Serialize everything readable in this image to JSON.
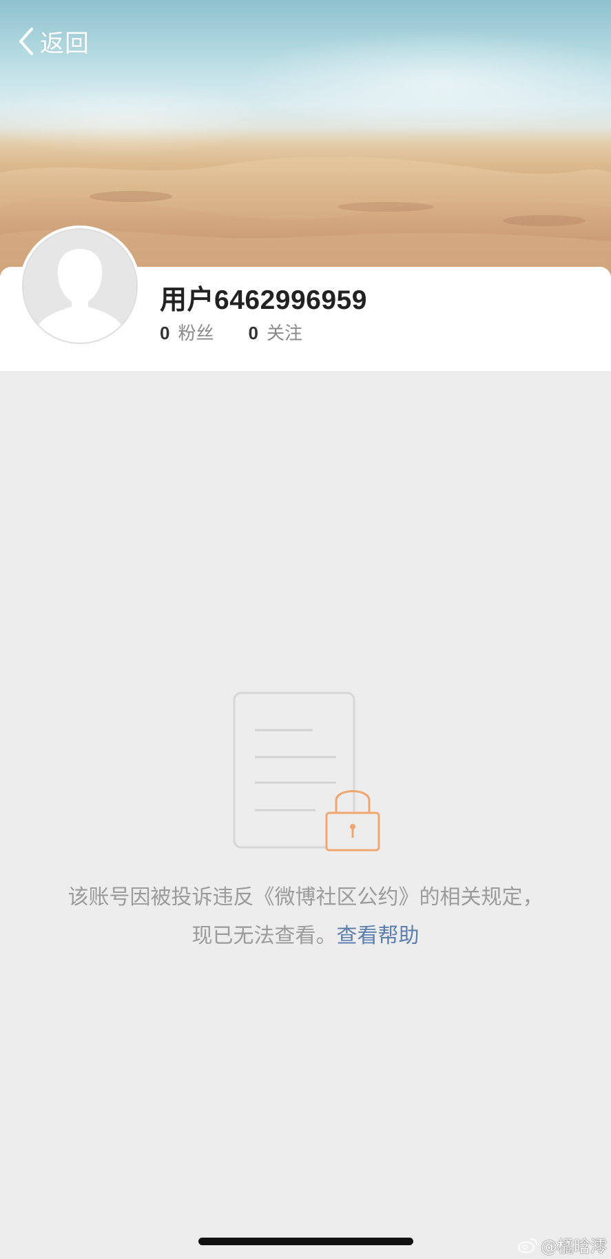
{
  "nav": {
    "back_label": "返回"
  },
  "profile": {
    "username": "用户6462996959",
    "followers_count": "0",
    "followers_label": "粉丝",
    "following_count": "0",
    "following_label": "关注"
  },
  "notice": {
    "text": "该账号因被投诉违反《微博社区公约》的相关规定，现已无法查看。",
    "help_link": "查看帮助"
  },
  "watermark": {
    "text": "@橘晗澪"
  },
  "colors": {
    "background": "#ededed",
    "link": "#5b7fae",
    "lock": "#f0a66e",
    "muted_text": "#9b9b9b"
  }
}
